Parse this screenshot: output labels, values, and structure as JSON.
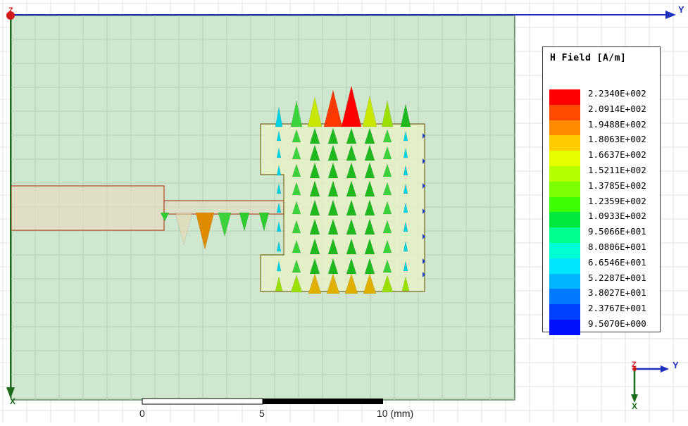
{
  "legend": {
    "title": "H Field [A/m]",
    "entries": [
      {
        "value": "2.2340E+002",
        "color": "#ff0000"
      },
      {
        "value": "2.0914E+002",
        "color": "#ff4a00"
      },
      {
        "value": "1.9488E+002",
        "color": "#ff8a00"
      },
      {
        "value": "1.8063E+002",
        "color": "#ffcc00"
      },
      {
        "value": "1.6637E+002",
        "color": "#e6ff00"
      },
      {
        "value": "1.5211E+002",
        "color": "#b6ff00"
      },
      {
        "value": "1.3785E+002",
        "color": "#7cff00"
      },
      {
        "value": "1.2359E+002",
        "color": "#3cff00"
      },
      {
        "value": "1.0933E+002",
        "color": "#00e83c"
      },
      {
        "value": "9.5066E+001",
        "color": "#00ff8c"
      },
      {
        "value": "8.0806E+001",
        "color": "#00ffd2"
      },
      {
        "value": "6.6546E+001",
        "color": "#00e6ff"
      },
      {
        "value": "5.2287E+001",
        "color": "#00b4ff"
      },
      {
        "value": "3.8027E+001",
        "color": "#0078ff"
      },
      {
        "value": "2.3767E+001",
        "color": "#0040ff"
      },
      {
        "value": "9.5070E+000",
        "color": "#0010ff"
      }
    ]
  },
  "scale_bar": {
    "labels": [
      "0",
      "5",
      "10 (mm)"
    ]
  },
  "axes": {
    "main_y": "Y",
    "main_x": "X",
    "main_z": "Z",
    "triad_y": "Y",
    "triad_x": "X",
    "triad_z": "Z"
  },
  "colors": {
    "substrate_fill": "#cfe6cf",
    "feedline_fill": "#e4dcc2",
    "patch_fill": "#e6f0c6",
    "outline": "#b04a2a",
    "axis_blue": "#1f2fbf",
    "axis_green": "#1a6b1a",
    "axis_red": "#d01a1a"
  },
  "icons": [
    "h-field-cone-arrows",
    "axis-triad"
  ]
}
